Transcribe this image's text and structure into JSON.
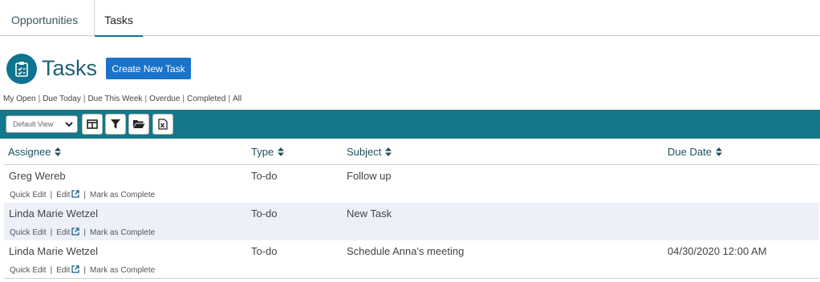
{
  "tabs": [
    {
      "label": "Opportunities"
    },
    {
      "label": "Tasks"
    }
  ],
  "page": {
    "title": "Tasks",
    "create_button": "Create New Task",
    "icon": "clipboard-icon"
  },
  "filters": [
    "My Open",
    "Due Today",
    "Due This Week",
    "Overdue",
    "Completed",
    "All"
  ],
  "toolbar": {
    "view_select": "Default View",
    "buttons": [
      "columns-icon",
      "filter-icon",
      "folder-open-icon",
      "excel-export-icon"
    ]
  },
  "columns": [
    "Assignee",
    "Type",
    "Subject",
    "Due Date"
  ],
  "actions": {
    "quick_edit": "Quick Edit",
    "edit": "Edit",
    "mark_complete": "Mark as Complete"
  },
  "rows": [
    {
      "assignee": "Greg Wereb",
      "type": "To-do",
      "subject": "Follow up",
      "due": ""
    },
    {
      "assignee": "Linda Marie Wetzel",
      "type": "To-do",
      "subject": "New Task",
      "due": ""
    },
    {
      "assignee": "Linda Marie Wetzel",
      "type": "To-do",
      "subject": "Schedule Anna's meeting",
      "due": "04/30/2020 12:00 AM"
    }
  ],
  "colors": {
    "accent": "#137889",
    "button": "#1a73c8",
    "alt_row": "#eef0f9"
  }
}
